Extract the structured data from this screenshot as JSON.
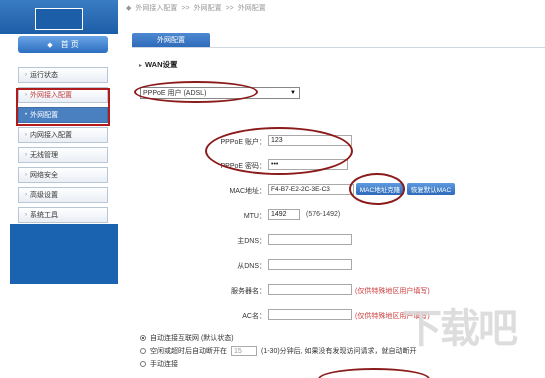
{
  "breadcrumb": {
    "home_symbol": "◆",
    "items": [
      "外网接入配置",
      ">>",
      "外网配置",
      ">>",
      "外网配置"
    ]
  },
  "sidebar": {
    "home_label": "首 页",
    "home_icon": "diamond-icon",
    "items": [
      {
        "label": "运行状态"
      },
      {
        "label": "外网接入配置"
      },
      {
        "label": "外网配置"
      },
      {
        "label": "内网接入配置"
      },
      {
        "label": "无线管理"
      },
      {
        "label": "网络安全"
      },
      {
        "label": "高级设置"
      },
      {
        "label": "系统工具"
      }
    ]
  },
  "tab": {
    "label": "外网配置"
  },
  "section": {
    "title": "WAN设置"
  },
  "wan_type": {
    "value": "PPPoE 用户 (ADSL)"
  },
  "form": {
    "pppoe_account_label": "PPPoE 账户：",
    "pppoe_account_value": "123",
    "pppoe_password_label": "PPPoE 密码：",
    "pppoe_password_value": "•••",
    "mac_label": "MAC地址：",
    "mac_value": "F4-B7-E2-2C-3E-C3",
    "mac_clone_button": "MAC地址克隆",
    "mac_restore_button": "恢复默认MAC",
    "mtu_label": "MTU：",
    "mtu_value": "1492",
    "mtu_range": "(576-1492)",
    "primary_dns_label": "主DNS：",
    "secondary_dns_label": "从DNS：",
    "service_name_label": "服务器名：",
    "service_name_hint": "(仅供特殊地区用户填写)",
    "ac_name_label": "AC名：",
    "ac_name_hint": "(仅供特殊地区用户填写)"
  },
  "connect_options": {
    "auto": "自动连接互联网 (默认状态)",
    "idle_prefix": "空闲或超时后自动断开在",
    "idle_value": "15",
    "idle_suffix": "(1-30)分钟后, 如果没有发现访问请求，就自动断开",
    "manual": "手动连接",
    "selected": "auto"
  },
  "watermark": "下载吧",
  "colors": {
    "accent_blue": "#2c6fc0",
    "highlight_red": "#8b1a1a",
    "hint_red": "#cc3b3b"
  }
}
